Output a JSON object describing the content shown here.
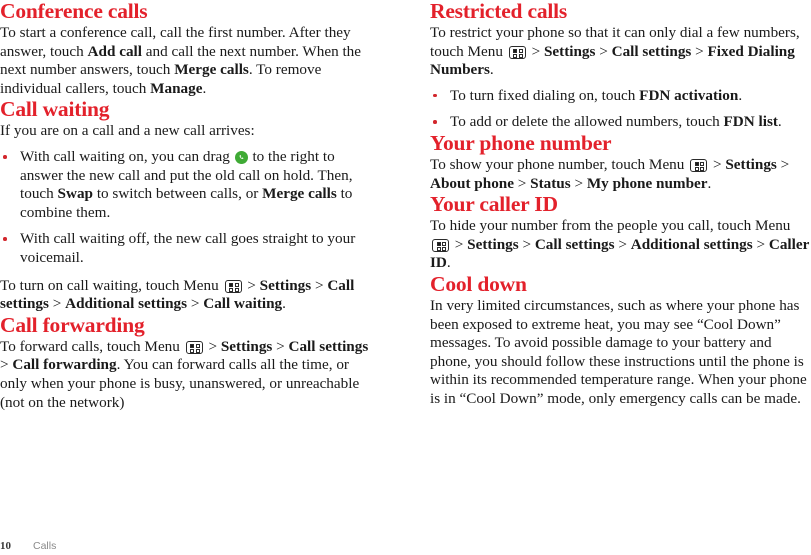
{
  "document": {
    "page_number": "10",
    "chapter": "Calls"
  },
  "colors": {
    "heading_red": "#e3212b",
    "bullet_red": "#d2262c",
    "answer_green": "#3faa35",
    "body_text": "#1a1a1a",
    "footer_gray": "#8a8a8a"
  },
  "icons": {
    "menu_key": "menu-key-icon",
    "answer_call": "answer-call-icon"
  },
  "left_column": {
    "sections": [
      {
        "id": "conference-calls",
        "heading": "Conference calls",
        "paragraph_parts": [
          {
            "t": "To start a conference call, call the first number. After they answer, touch ",
            "b": false
          },
          {
            "t": "Add call",
            "b": true
          },
          {
            "t": " and call the next number. When the next number answers, touch ",
            "b": false
          },
          {
            "t": "Merge calls",
            "b": true
          },
          {
            "t": ". To remove individual callers, touch ",
            "b": false
          },
          {
            "t": "Manage",
            "b": true
          },
          {
            "t": ".",
            "b": false
          }
        ]
      },
      {
        "id": "call-waiting",
        "heading": "Call waiting",
        "intro": "If you are on a call and a new call arrives:",
        "bullets": [
          {
            "parts": [
              {
                "t": "With call waiting on, you can drag ",
                "b": false
              },
              {
                "icon": "answer-call-icon"
              },
              {
                "t": " to the right to answer the new call and put the old call on hold. Then, touch ",
                "b": false
              },
              {
                "t": "Swap",
                "b": true
              },
              {
                "t": " to switch between calls, or ",
                "b": false
              },
              {
                "t": "Merge calls",
                "b": true
              },
              {
                "t": " to combine them.",
                "b": false
              }
            ]
          },
          {
            "parts": [
              {
                "t": "With call waiting off, the new call goes straight to your voicemail.",
                "b": false
              }
            ]
          }
        ],
        "closing_parts": [
          {
            "t": "To turn on call waiting, touch Menu ",
            "b": false
          },
          {
            "icon": "menu-key-icon"
          },
          {
            "t": " > ",
            "b": false
          },
          {
            "t": "Settings",
            "b": true
          },
          {
            "t": " > ",
            "b": false
          },
          {
            "t": "Call settings",
            "b": true
          },
          {
            "t": " > ",
            "b": false
          },
          {
            "t": "Additional settings",
            "b": true
          },
          {
            "t": " > ",
            "b": false
          },
          {
            "t": "Call waiting",
            "b": true
          },
          {
            "t": ".",
            "b": false
          }
        ]
      },
      {
        "id": "call-forwarding",
        "heading": "Call forwarding",
        "paragraph_parts": [
          {
            "t": "To forward calls, touch Menu ",
            "b": false
          },
          {
            "icon": "menu-key-icon"
          },
          {
            "t": " > ",
            "b": false
          },
          {
            "t": "Settings",
            "b": true
          },
          {
            "t": " > ",
            "b": false
          },
          {
            "t": "Call settings",
            "b": true
          },
          {
            "t": " > ",
            "b": false
          },
          {
            "t": "Call forwarding",
            "b": true
          },
          {
            "t": ". You can forward calls all the time, or only when your phone is busy, unanswered, or unreachable (not on the network)",
            "b": false
          }
        ]
      }
    ]
  },
  "right_column": {
    "sections": [
      {
        "id": "restricted-calls",
        "heading": "Restricted calls",
        "paragraph_parts": [
          {
            "t": "To restrict your phone so that it can only dial a few numbers, touch Menu ",
            "b": false
          },
          {
            "icon": "menu-key-icon"
          },
          {
            "t": " > ",
            "b": false
          },
          {
            "t": "Settings",
            "b": true
          },
          {
            "t": " > ",
            "b": false
          },
          {
            "t": "Call settings",
            "b": true
          },
          {
            "t": " > ",
            "b": false
          },
          {
            "t": "Fixed Dialing Numbers",
            "b": true
          },
          {
            "t": ".",
            "b": false
          }
        ],
        "bullets": [
          {
            "parts": [
              {
                "t": "To turn fixed dialing on, touch ",
                "b": false
              },
              {
                "t": "FDN activation",
                "b": true
              },
              {
                "t": ".",
                "b": false
              }
            ]
          },
          {
            "parts": [
              {
                "t": "To add or delete the allowed numbers, touch ",
                "b": false
              },
              {
                "t": "FDN list",
                "b": true
              },
              {
                "t": ".",
                "b": false
              }
            ]
          }
        ]
      },
      {
        "id": "your-phone-number",
        "heading": "Your phone number",
        "paragraph_parts": [
          {
            "t": "To show your phone number, touch Menu ",
            "b": false
          },
          {
            "icon": "menu-key-icon"
          },
          {
            "t": " > ",
            "b": false
          },
          {
            "t": "Settings",
            "b": true
          },
          {
            "t": " > ",
            "b": false
          },
          {
            "t": "About phone",
            "b": true
          },
          {
            "t": " > ",
            "b": false
          },
          {
            "t": "Status",
            "b": true
          },
          {
            "t": " > ",
            "b": false
          },
          {
            "t": "My phone number",
            "b": true
          },
          {
            "t": ".",
            "b": false
          }
        ]
      },
      {
        "id": "your-caller-id",
        "heading": "Your caller ID",
        "paragraph_parts": [
          {
            "t": "To hide your number from the people you call, touch Menu ",
            "b": false
          },
          {
            "icon": "menu-key-icon"
          },
          {
            "t": " > ",
            "b": false
          },
          {
            "t": "Settings",
            "b": true
          },
          {
            "t": " > ",
            "b": false
          },
          {
            "t": "Call settings",
            "b": true
          },
          {
            "t": " > ",
            "b": false
          },
          {
            "t": "Additional settings",
            "b": true
          },
          {
            "t": " > ",
            "b": false
          },
          {
            "t": "Caller ID",
            "b": true
          },
          {
            "t": ".",
            "b": false
          }
        ]
      },
      {
        "id": "cool-down",
        "heading": "Cool down",
        "paragraph_parts": [
          {
            "t": "In very limited circumstances, such as where your phone has been exposed to extreme heat, you may see “Cool Down” messages. To avoid possible damage to your battery and phone, you should follow these instructions until the phone is within its recommended temperature range. When your phone is in “Cool Down” mode, only emergency calls can be made.",
            "b": false
          }
        ]
      }
    ]
  }
}
